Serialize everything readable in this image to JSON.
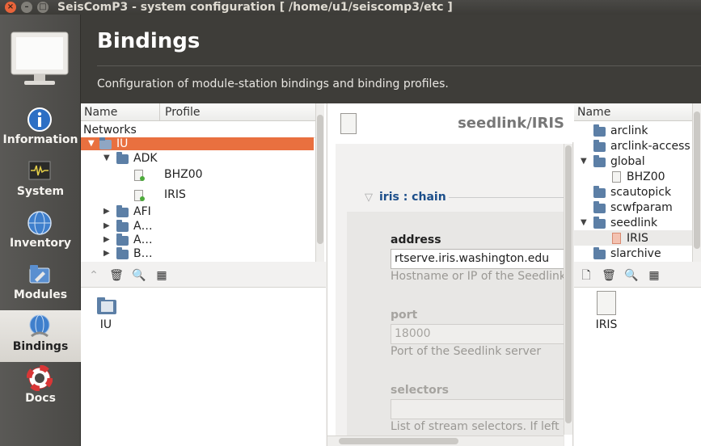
{
  "window": {
    "title": "SeisComP3 - system configuration [ /home/u1/seiscomp3/etc ]"
  },
  "nav": {
    "items": [
      {
        "label": "Information",
        "icon": "info-icon"
      },
      {
        "label": "System",
        "icon": "system-monitor-icon"
      },
      {
        "label": "Inventory",
        "icon": "globe-icon"
      },
      {
        "label": "Modules",
        "icon": "modules-icon"
      },
      {
        "label": "Bindings",
        "icon": "bindings-globe-icon",
        "active": true
      },
      {
        "label": "Docs",
        "icon": "lifebuoy-icon"
      }
    ]
  },
  "header": {
    "title": "Bindings",
    "description": "Configuration of module-station bindings and binding profiles."
  },
  "station_tree": {
    "columns": [
      "Name",
      "Profile"
    ],
    "root_label": "Networks",
    "network": "IU",
    "station": "ADK",
    "bindings": [
      {
        "name": "BHZ00",
        "profile": ""
      },
      {
        "profile": "IRIS"
      }
    ],
    "other_stations": [
      "AFI",
      "A…",
      "A…",
      "B…"
    ]
  },
  "station_bottom": {
    "item_label": "IU"
  },
  "editor": {
    "title": "seedlink/IRIS",
    "section": "iris : chain",
    "fields": [
      {
        "label": "address",
        "value": "rtserve.iris.washington.edu",
        "hint": "Hostname or IP of the Seedlink",
        "enabled": true
      },
      {
        "label": "port",
        "value": "18000",
        "hint": "Port of the Seedlink server",
        "enabled": false
      },
      {
        "label": "selectors",
        "value": "",
        "hint": "List of stream selectors. If left e",
        "enabled": false
      }
    ]
  },
  "profile_tree": {
    "column": "Name",
    "items": [
      {
        "label": "arclink",
        "level": 1,
        "type": "folder"
      },
      {
        "label": "arclink-access",
        "level": 1,
        "type": "folder"
      },
      {
        "label": "global",
        "level": 1,
        "type": "folder",
        "expanded": true
      },
      {
        "label": "BHZ00",
        "level": 2,
        "type": "file"
      },
      {
        "label": "scautopick",
        "level": 1,
        "type": "folder"
      },
      {
        "label": "scwfparam",
        "level": 1,
        "type": "folder"
      },
      {
        "label": "seedlink",
        "level": 1,
        "type": "folder",
        "expanded": true
      },
      {
        "label": "IRIS",
        "level": 2,
        "type": "file",
        "selected": true
      },
      {
        "label": "slarchive",
        "level": 1,
        "type": "folder"
      }
    ]
  },
  "profile_bottom": {
    "item_label": "IRIS"
  },
  "colors": {
    "selection": "#e9703f",
    "header_bg": "#3e3d39",
    "nav_bg": "#4a4946"
  }
}
